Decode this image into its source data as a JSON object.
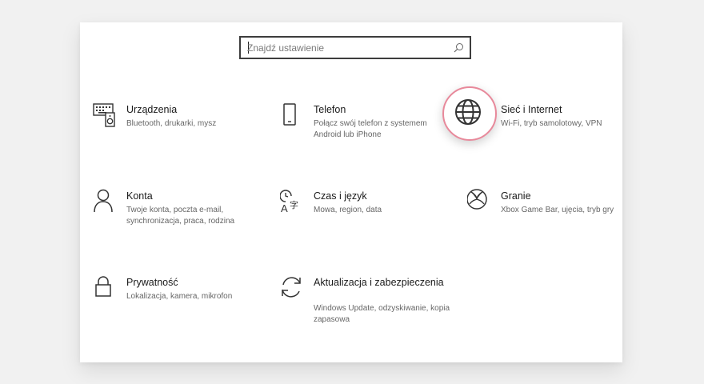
{
  "search": {
    "placeholder": "Znajdź ustawienie"
  },
  "tiles": [
    {
      "title": "Urządzenia",
      "desc": "Bluetooth, drukarki, mysz",
      "icon": "devices-icon"
    },
    {
      "title": "Telefon",
      "desc": "Połącz swój telefon z systemem Android lub iPhone",
      "icon": "phone-icon"
    },
    {
      "title": "Sieć i Internet",
      "desc": "Wi-Fi, tryb samolotowy, VPN",
      "icon": "globe-icon",
      "highlight_color": "#e8899b"
    },
    {
      "title": "Konta",
      "desc": "Twoje konta, poczta e-mail, synchronizacja, praca, rodzina",
      "icon": "person-icon"
    },
    {
      "title": "Czas i język",
      "desc": "Mowa, region, data",
      "icon": "time-language-icon"
    },
    {
      "title": "Granie",
      "desc": "Xbox Game Bar, ujęcia, tryb gry",
      "icon": "xbox-icon"
    },
    {
      "title": "Prywatność",
      "desc": "Lokalizacja, kamera, mikrofon",
      "icon": "lock-icon"
    },
    {
      "title": "Aktualizacja i zabezpieczenia",
      "desc": "Windows Update, odzyskiwanie, kopia zapasowa",
      "icon": "update-icon"
    }
  ]
}
